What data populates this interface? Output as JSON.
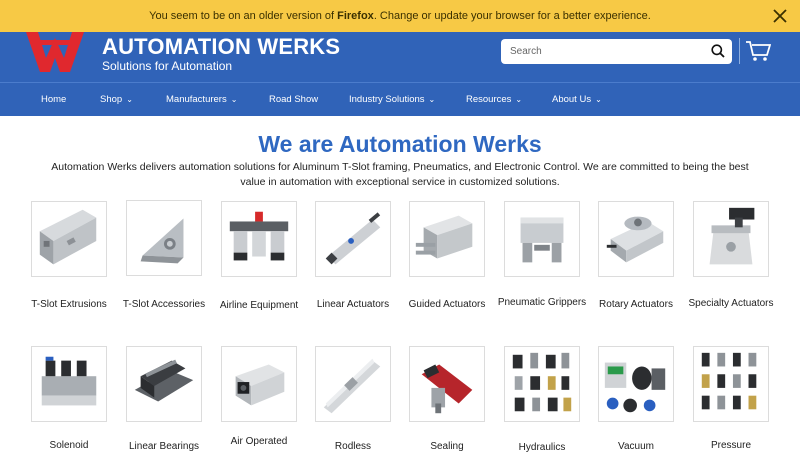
{
  "banner": {
    "prefix": "You seem to be on an older version of ",
    "browser": "Firefox",
    "suffix": ". Change or update your browser for a better experience."
  },
  "header": {
    "brand": "AUTOMATION WERKS",
    "tagline": "Solutions for Automation",
    "search_placeholder": "Search",
    "brand_color": "#3063b8",
    "banner_color": "#f7c945"
  },
  "nav": {
    "items": [
      {
        "label": "Home"
      },
      {
        "label": "Shop"
      },
      {
        "label": "Manufacturers"
      },
      {
        "label": "Road Show"
      },
      {
        "label": "Industry Solutions"
      },
      {
        "label": "Resources"
      },
      {
        "label": "About Us"
      }
    ]
  },
  "main": {
    "headline": "We are Automation Werks",
    "intro": "Automation Werks delivers automation solutions for Aluminum T-Slot framing, Pneumatics, and Electronic Control. We are committed to being the best value in automation with exceptional service in customized solutions."
  },
  "categories": [
    {
      "label": "T-Slot Extrusions"
    },
    {
      "label": "T-Slot Accessories"
    },
    {
      "label": "Airline Equipment"
    },
    {
      "label": "Linear Actuators"
    },
    {
      "label": "Guided Actuators"
    },
    {
      "label": "Pneumatic Grippers"
    },
    {
      "label": "Rotary Actuators"
    },
    {
      "label": "Specialty Actuators"
    },
    {
      "label": "Solenoid"
    },
    {
      "label": "Linear Bearings"
    },
    {
      "label": "Air Operated"
    },
    {
      "label": "Rodless"
    },
    {
      "label": "Sealing"
    },
    {
      "label": "Hydraulics"
    },
    {
      "label": "Vacuum"
    },
    {
      "label": "Pressure"
    }
  ]
}
